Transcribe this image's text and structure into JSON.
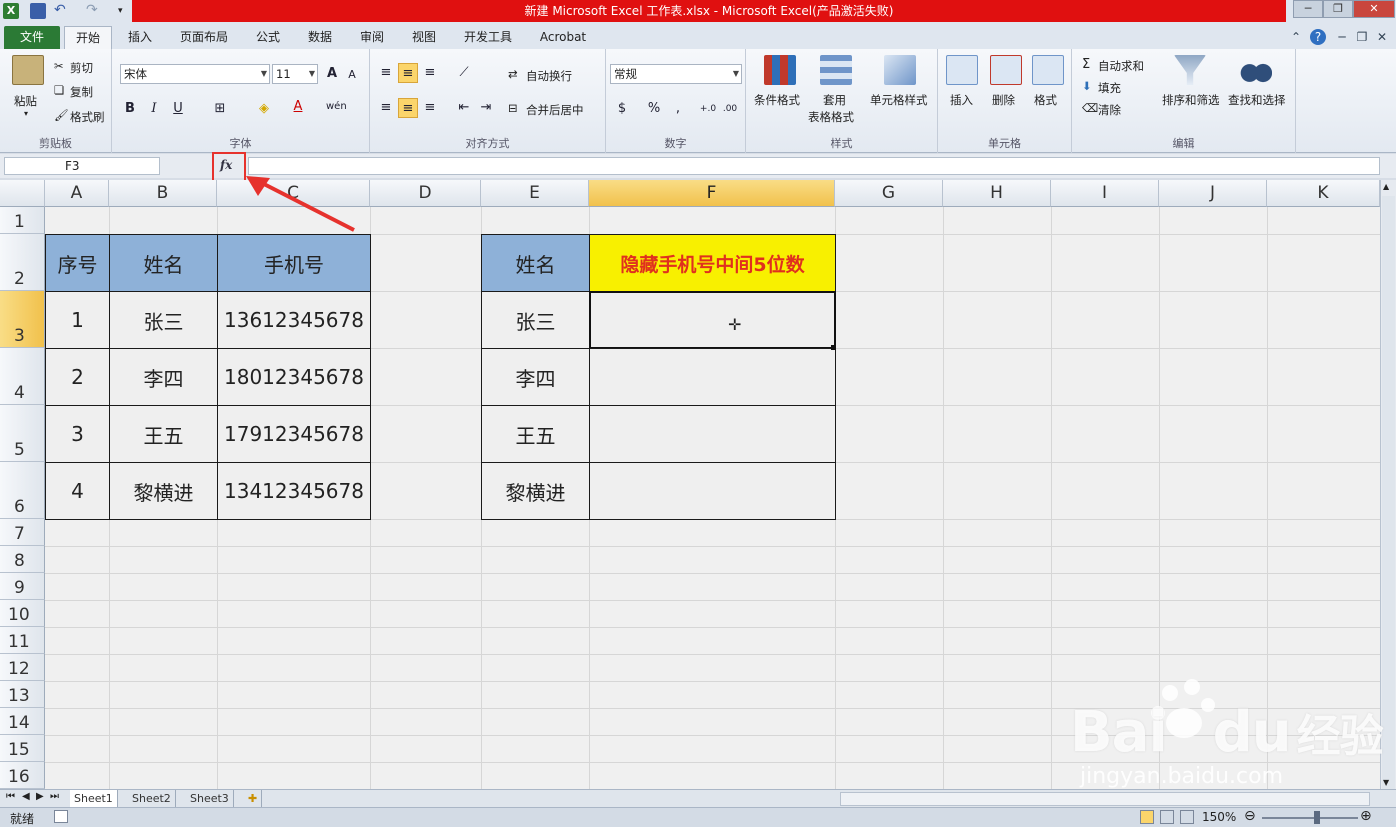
{
  "window": {
    "title": "新建 Microsoft Excel 工作表.xlsx - Microsoft Excel(产品激活失败)"
  },
  "tabs": [
    {
      "label": "文件"
    },
    {
      "label": "开始"
    },
    {
      "label": "插入"
    },
    {
      "label": "页面布局"
    },
    {
      "label": "公式"
    },
    {
      "label": "数据"
    },
    {
      "label": "审阅"
    },
    {
      "label": "视图"
    },
    {
      "label": "开发工具"
    },
    {
      "label": "Acrobat"
    }
  ],
  "ribbon": {
    "clipboard": {
      "paste": "粘贴",
      "cut": "剪切",
      "copy": "复制",
      "format_painter": "格式刷",
      "label": "剪贴板"
    },
    "font": {
      "name": "宋体",
      "size": "11",
      "label": "字体",
      "bold": "B",
      "italic": "I",
      "underline": "U",
      "grow": "A",
      "shrink": "A",
      "color": "A",
      "wen": "wén"
    },
    "align": {
      "wrap": "自动换行",
      "merge": "合并后居中",
      "label": "对齐方式"
    },
    "number": {
      "format": "常规",
      "label": "数字",
      "currency": "$",
      "percent": "%",
      "comma": ",",
      "inc": "+.0",
      "dec": ".00"
    },
    "styles": {
      "cond": "条件格式",
      "table1": "套用",
      "table2": "表格格式",
      "cell": "单元格样式",
      "label": "样式"
    },
    "cells": {
      "insert": "插入",
      "delete": "删除",
      "format": "格式",
      "label": "单元格"
    },
    "edit": {
      "autosum": "自动求和",
      "fill": "填充",
      "clear": "清除",
      "sort": "排序和筛选",
      "find": "查找和选择",
      "label": "编辑"
    }
  },
  "formula_bar": {
    "name_box": "F3",
    "fx": "fx"
  },
  "columns": [
    "A",
    "B",
    "C",
    "D",
    "E",
    "F",
    "G",
    "H",
    "I",
    "J",
    "K"
  ],
  "rows": [
    "1",
    "2",
    "3",
    "4",
    "5",
    "6",
    "7",
    "8",
    "9",
    "10",
    "11",
    "12",
    "13",
    "14",
    "15",
    "16"
  ],
  "table1": {
    "headers": [
      "序号",
      "姓名",
      "手机号"
    ],
    "rows": [
      [
        "1",
        "张三",
        "13612345678"
      ],
      [
        "2",
        "李四",
        "18012345678"
      ],
      [
        "3",
        "王五",
        "17912345678"
      ],
      [
        "4",
        "黎横进",
        "13412345678"
      ]
    ]
  },
  "table2": {
    "headers": [
      "姓名",
      "隐藏手机号中间5位数"
    ],
    "rows": [
      [
        "张三",
        ""
      ],
      [
        "李四",
        ""
      ],
      [
        "王五",
        ""
      ],
      [
        "黎横进",
        ""
      ]
    ]
  },
  "sheets": [
    "Sheet1",
    "Sheet2",
    "Sheet3"
  ],
  "status": {
    "mode": "就绪",
    "zoom": "150%"
  },
  "watermark": {
    "brand": "Bai",
    "brand2": "du",
    "cn": "经验",
    "url": "jingyan.baidu.com"
  },
  "colors": {
    "accent_red": "#e01010",
    "header_blue": "#8eb1d8",
    "highlight_yellow": "#f8f000",
    "file_green": "#2b7a35"
  }
}
